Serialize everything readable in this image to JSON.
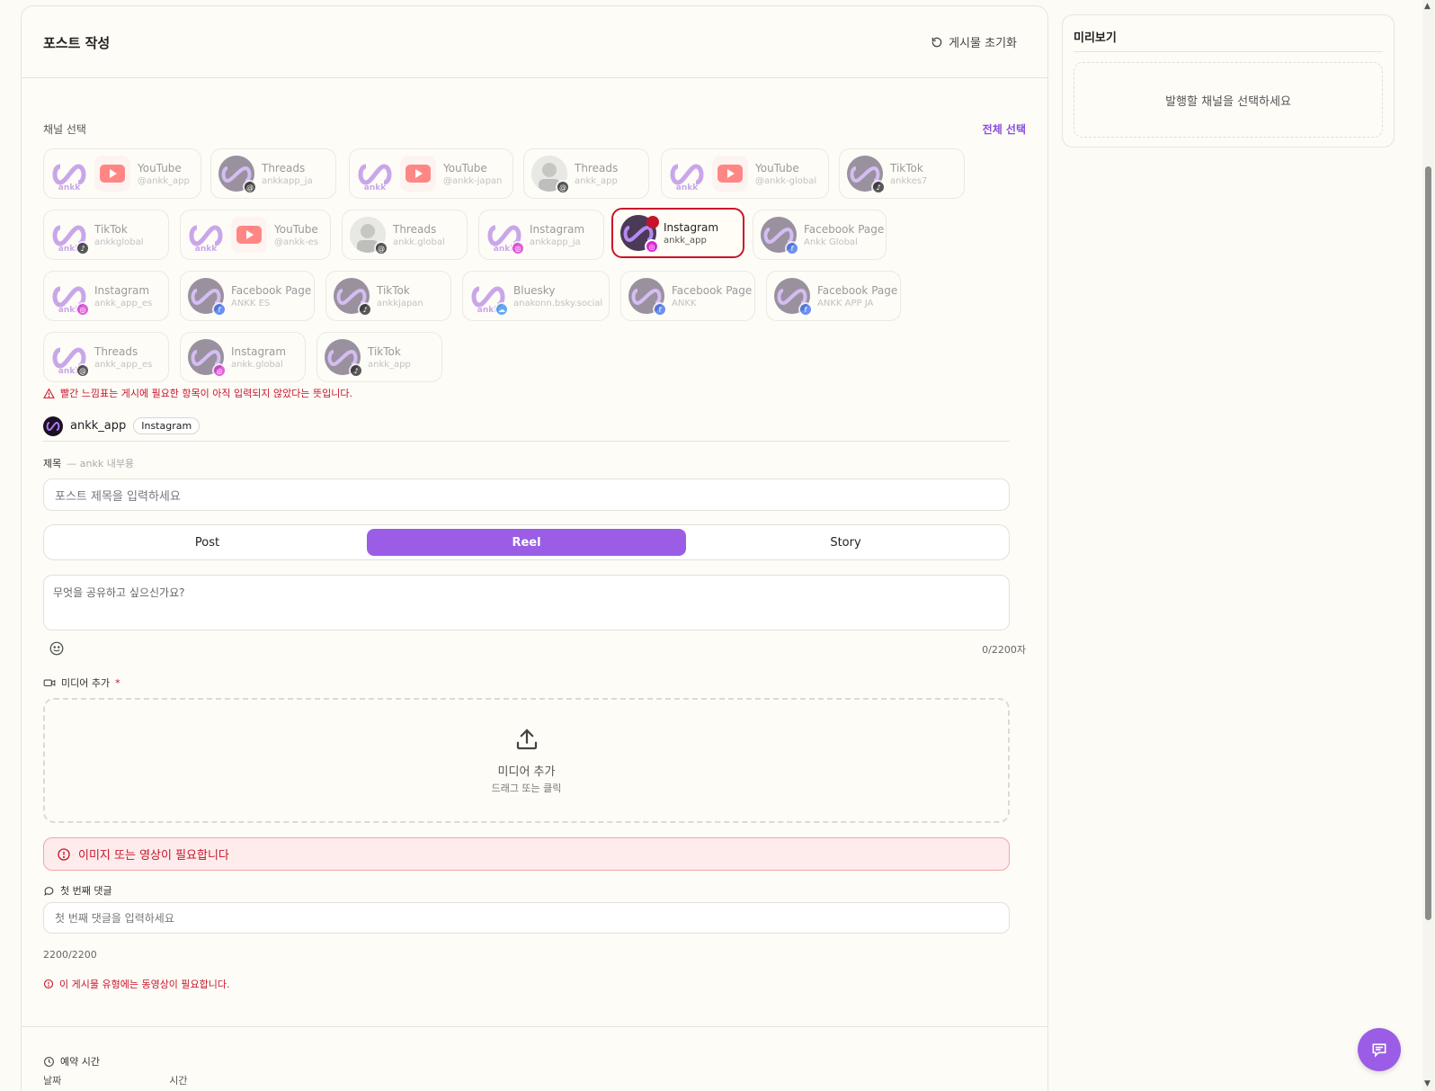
{
  "header": {
    "title": "포스트 작성",
    "reset_label": "게시물 초기화"
  },
  "channels": {
    "label": "채널 선택",
    "select_all": "전체 선택",
    "items": [
      {
        "name": "YouTube",
        "handle": "@ankk_app",
        "platform": "youtube"
      },
      {
        "name": "Threads",
        "handle": "ankkapp_ja",
        "platform": "threads"
      },
      {
        "name": "YouTube",
        "handle": "@ankk-japan",
        "platform": "youtube"
      },
      {
        "name": "Threads",
        "handle": "ankk_app",
        "platform": "threads"
      },
      {
        "name": "YouTube",
        "handle": "@ankk-global",
        "platform": "youtube"
      },
      {
        "name": "TikTok",
        "handle": "ankkes7",
        "platform": "tiktok"
      },
      {
        "name": "TikTok",
        "handle": "ankkglobal",
        "platform": "tiktok"
      },
      {
        "name": "YouTube",
        "handle": "@ankk-es",
        "platform": "youtube"
      },
      {
        "name": "Threads",
        "handle": "ankk.global",
        "platform": "threads"
      },
      {
        "name": "Instagram",
        "handle": "ankkapp_ja",
        "platform": "instagram"
      },
      {
        "name": "Instagram",
        "handle": "ankk_app",
        "platform": "instagram",
        "selected": true
      },
      {
        "name": "Facebook Page",
        "handle": "Ankk Global",
        "platform": "facebook"
      },
      {
        "name": "Instagram",
        "handle": "ankk_app_es",
        "platform": "instagram"
      },
      {
        "name": "Facebook Page",
        "handle": "ANKK ES",
        "platform": "facebook"
      },
      {
        "name": "TikTok",
        "handle": "ankkjapan",
        "platform": "tiktok"
      },
      {
        "name": "Bluesky",
        "handle": "anakonn.bsky.social",
        "platform": "bluesky"
      },
      {
        "name": "Facebook Page",
        "handle": "ANKK",
        "platform": "facebook"
      },
      {
        "name": "Facebook Page",
        "handle": "ANKK APP JA",
        "platform": "facebook"
      },
      {
        "name": "Threads",
        "handle": "ankk_app_es",
        "platform": "threads"
      },
      {
        "name": "Instagram",
        "handle": "ankk.global",
        "platform": "instagram"
      },
      {
        "name": "TikTok",
        "handle": "ankk_app",
        "platform": "tiktok"
      }
    ],
    "warning": "빨간 느낌표는 게시에 필요한 항목이 아직 입력되지 않았다는 뜻입니다."
  },
  "account": {
    "name": "ankk_app",
    "platform_tag": "Instagram"
  },
  "title_field": {
    "label": "제목",
    "sub": "— ankk 내부용",
    "placeholder": "포스트 제목을 입력하세요"
  },
  "post_types": {
    "tabs": [
      "Post",
      "Reel",
      "Story"
    ],
    "active": "Reel"
  },
  "content": {
    "placeholder": "무엇을 공유하고 싶으신가요?",
    "counter": "0/2200자"
  },
  "media": {
    "label": "미디어 추가",
    "required_mark": "*",
    "drop_title": "미디어 추가",
    "drop_sub": "드래그 또는 클릭",
    "error": "이미지 또는 영상이 필요합니다"
  },
  "first_comment": {
    "label": "첫 번째 댓글",
    "placeholder": "첫 번째 댓글을 입력하세요",
    "counter": "2200/2200"
  },
  "type_error": "이 게시물 유형에는 동영상이 필요합니다.",
  "schedule": {
    "label": "예약 시간",
    "date_label": "날짜",
    "time_label": "시간"
  },
  "preview": {
    "title": "미리보기",
    "empty": "발행할 채널을 선택하세요"
  },
  "colors": {
    "accent": "#9b5de5",
    "error": "#c8142a",
    "youtube": "#ff3b3b",
    "instagram": "#d62dd0",
    "facebook": "#3b6cf0",
    "threads": "#222222",
    "bluesky": "#2f8ef0"
  }
}
